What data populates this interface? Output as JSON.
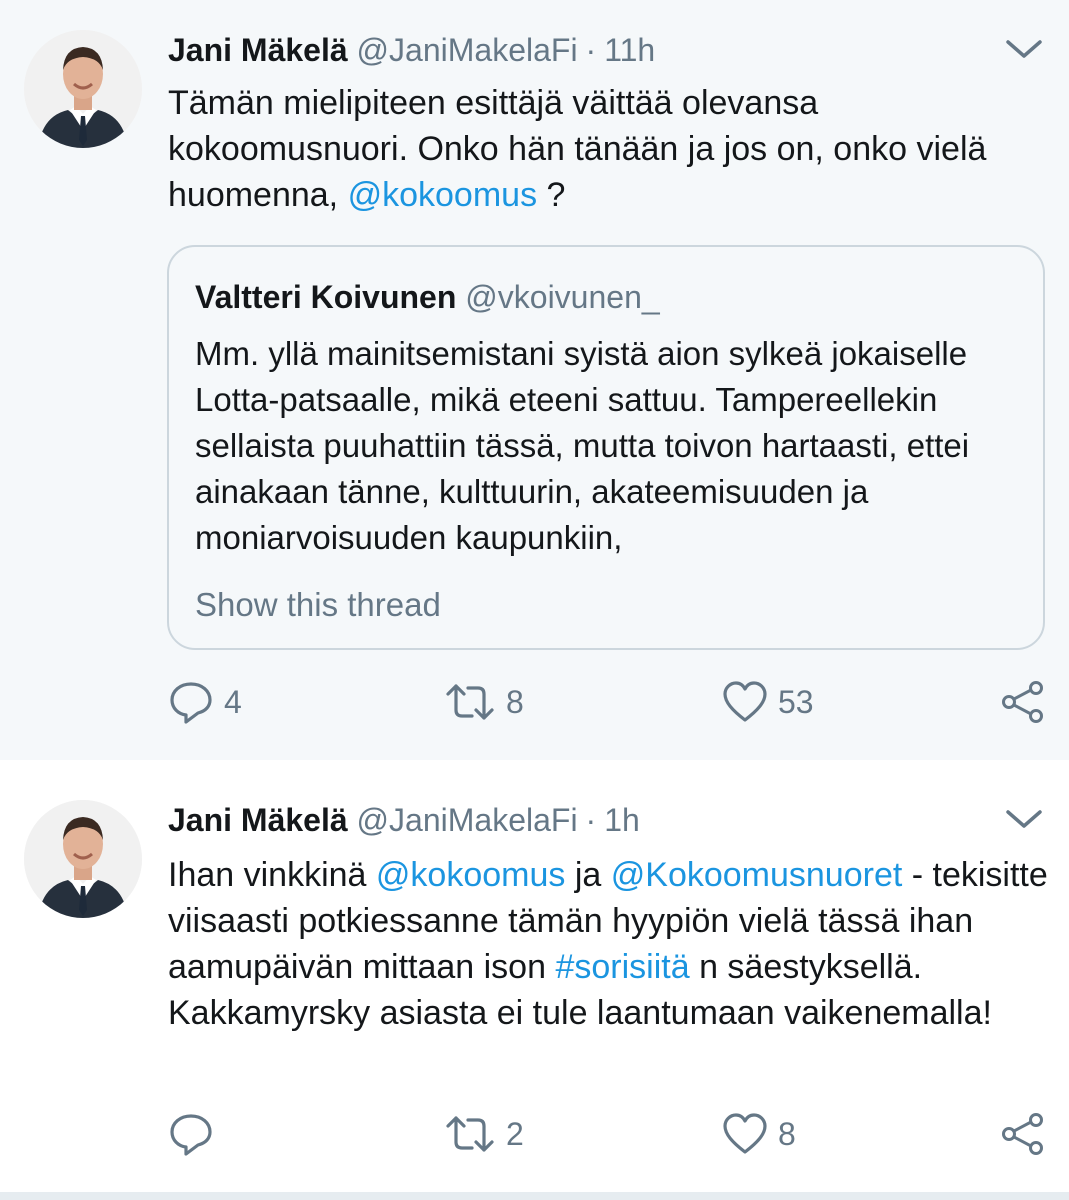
{
  "tweets": [
    {
      "author_name": "Jani Mäkelä",
      "author_handle": "@JaniMakelaFi",
      "separator": "·",
      "time": "11h",
      "text_parts": [
        "Tämän mielipiteen esittäjä väittää olevansa kokoomusnuori. Onko hän tänään ja jos on, onko vielä huomenna, ",
        "@kokoomus",
        " ?"
      ],
      "quoted": {
        "author_name": "Valtteri Koivunen",
        "author_handle": "@vkoivunen_",
        "text": "Mm. yllä mainitsemistani syistä aion sylkeä jokaiselle Lotta-patsaalle, mikä eteeni sattuu. Tampereellekin sellaista puuhattiin tässä, mutta toivon hartaasti, ettei ainakaan tänne, kulttuurin, akateemisuuden ja moniarvoisuuden kaupunkiin,",
        "show_thread": "Show this thread"
      },
      "reply_count": "4",
      "retweet_count": "8",
      "like_count": "53"
    },
    {
      "author_name": "Jani Mäkelä",
      "author_handle": "@JaniMakelaFi",
      "separator": "·",
      "time": "1h",
      "text_parts": [
        "Ihan vinkkinä ",
        "@kokoomus",
        " ja ",
        "@Kokoomusnuoret",
        " - tekisitte viisaasti potkiessanne tämän hyypiön vielä tässä ihan aamupäivän mittaan ison ",
        "#sorisiitä",
        " n säestyksellä. Kakkamyrsky asiasta ei tule laantumaan vaikenemalla!"
      ],
      "reply_count": "",
      "retweet_count": "2",
      "like_count": "8"
    }
  ],
  "colors": {
    "link": "#1b95e0",
    "secondary_text": "#657786",
    "highlight_background": "#f5f8fa",
    "thread_line": "#ccd6dd"
  },
  "icons": [
    "avatar",
    "chevron-down-icon",
    "reply-icon",
    "retweet-icon",
    "like-icon",
    "share-icon"
  ]
}
